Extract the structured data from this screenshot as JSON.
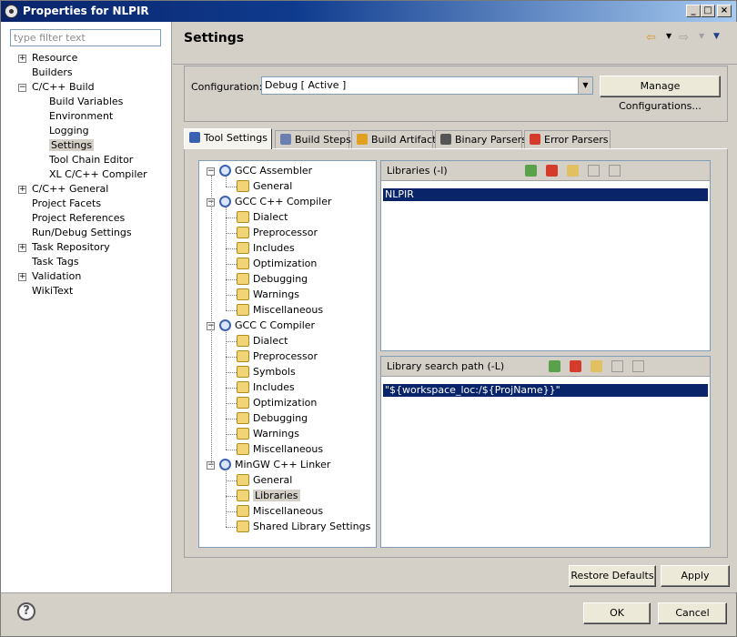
{
  "window": {
    "title": "Properties for NLPIR",
    "controls": [
      "_",
      "□",
      "×"
    ]
  },
  "sidebar": {
    "filter_placeholder": "type filter text",
    "items": [
      {
        "label": "Resource",
        "expandable": true
      },
      {
        "label": "Builders"
      },
      {
        "label": "C/C++ Build",
        "expanded": true
      },
      {
        "label": "Build Variables"
      },
      {
        "label": "Environment"
      },
      {
        "label": "Logging"
      },
      {
        "label": "Settings",
        "selected": true
      },
      {
        "label": "Tool Chain Editor"
      },
      {
        "label": "XL C/C++ Compiler"
      },
      {
        "label": "C/C++ General",
        "expandable": true
      },
      {
        "label": "Project Facets"
      },
      {
        "label": "Project References"
      },
      {
        "label": "Run/Debug Settings"
      },
      {
        "label": "Task Repository",
        "expandable": true
      },
      {
        "label": "Task Tags"
      },
      {
        "label": "Validation",
        "expandable": true
      },
      {
        "label": "WikiText"
      }
    ]
  },
  "page": {
    "title": "Settings"
  },
  "config": {
    "label": "Configuration:",
    "value": "Debug  [ Active ]",
    "manage_button": "Manage Configurations..."
  },
  "tabs": [
    {
      "label": "Tool Settings",
      "active": true,
      "icon": "tool-settings-icon"
    },
    {
      "label": "Build Steps",
      "icon": "build-steps-icon"
    },
    {
      "label": "Build Artifact",
      "icon": "build-artifact-icon"
    },
    {
      "label": "Binary Parsers",
      "icon": "binary-parsers-icon"
    },
    {
      "label": "Error Parsers",
      "icon": "error-parsers-icon"
    }
  ],
  "tool_tree": [
    {
      "label": "GCC Assembler",
      "type": "tool",
      "children": [
        "General"
      ]
    },
    {
      "label": "GCC C++ Compiler",
      "type": "tool",
      "children": [
        "Dialect",
        "Preprocessor",
        "Includes",
        "Optimization",
        "Debugging",
        "Warnings",
        "Miscellaneous"
      ]
    },
    {
      "label": "GCC C Compiler",
      "type": "tool",
      "children": [
        "Dialect",
        "Preprocessor",
        "Symbols",
        "Includes",
        "Optimization",
        "Debugging",
        "Warnings",
        "Miscellaneous"
      ]
    },
    {
      "label": "MinGW C++ Linker",
      "type": "tool",
      "children": [
        "General",
        "Libraries",
        "Miscellaneous",
        "Shared Library Settings"
      ]
    }
  ],
  "tool_tree_selected": "Libraries",
  "libraries": {
    "title": "Libraries (-l)",
    "items": [
      "NLPIR"
    ]
  },
  "library_paths": {
    "title": "Library search path (-L)",
    "items": [
      "\"${workspace_loc:/${ProjName}}\""
    ]
  },
  "buttons": {
    "restore_defaults": "Restore Defaults",
    "apply": "Apply",
    "ok": "OK",
    "cancel": "Cancel"
  },
  "help_label": "?"
}
